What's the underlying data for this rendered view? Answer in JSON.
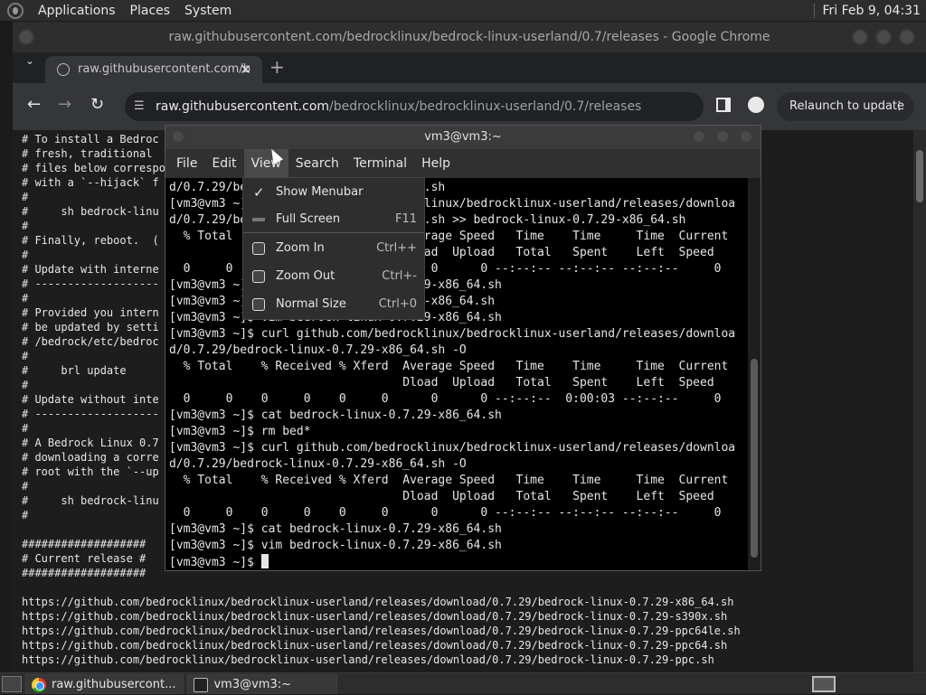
{
  "top_panel": {
    "menus": [
      "Applications",
      "Places",
      "System"
    ],
    "clock": "Fri Feb  9, 04:31"
  },
  "chrome": {
    "window_title": "raw.githubusercontent.com/bedrocklinux/bedrock-linux-userland/0.7/releases - Google Chrome",
    "tab_title": "raw.githubusercontent.com/b",
    "url_host": "raw.githubusercontent.com",
    "url_path": "/bedrocklinux/bedrocklinux-userland/0.7/releases",
    "relaunch_label": "Relaunch to update",
    "page_text": "# To install a Bedroc\n# fresh, traditional\n# files below correspo\n# with a `--hijack` f\n#\n#     sh bedrock-linu\n#\n# Finally, reboot.  (\n#\n# Update with interne\n# -------------------\n#\n# Provided you intern\n# be updated by setti\n# /bedrock/etc/bedroc\n#\n#     brl update\n#\n# Update without inte\n# -------------------\n#\n# A Bedrock Linux 0.7\n# downloading a corre\n# root with the `--up\n#\n#     sh bedrock-linu\n#\n\n################### \n# Current release # \n###################\n\nhttps://github.com/bedrocklinux/bedrocklinux-userland/releases/download/0.7.29/bedrock-linux-0.7.29-x86_64.sh\nhttps://github.com/bedrocklinux/bedrocklinux-userland/releases/download/0.7.29/bedrock-linux-0.7.29-s390x.sh\nhttps://github.com/bedrocklinux/bedrocklinux-userland/releases/download/0.7.29/bedrock-linux-0.7.29-ppc64le.sh\nhttps://github.com/bedrocklinux/bedrocklinux-userland/releases/download/0.7.29/bedrock-linux-0.7.29-ppc64.sh\nhttps://github.com/bedrocklinux/bedrocklinux-userland/releases/download/0.7.29/bedrock-linux-0.7.29-ppc.sh"
  },
  "terminal": {
    "title": "vm3@vm3:~",
    "menus": [
      "File",
      "Edit",
      "View",
      "Search",
      "Terminal",
      "Help"
    ],
    "output": "d/0.7.29/bedrock-linux-0.7.29-x86_64.sh\n[vm3@vm3 ~]$ curl github.com/bedrocklinux/bedrocklinux-userland/releases/downloa\nd/0.7.29/bedrock-linux-0.7.29-x86_64.sh >> bedrock-linux-0.7.29-x86_64.sh\n  % Total    % Received % Xferd  Average Speed   Time    Time     Time  Current\n                                 Dload  Upload   Total   Spent    Left  Speed\n  0     0    0     0    0     0      0      0 --:--:-- --:--:-- --:--:--     0\n[vm3@vm3 ~]$ cat bedrock-linux-0.7.29-x86_64.sh\n[vm3@vm3 ~]$ rm bedrock-linux-0.7.29-x86_64.sh\n[vm3@vm3 ~]$ vim bedrock-linux-0.7.29-x86_64.sh\n[vm3@vm3 ~]$ curl github.com/bedrocklinux/bedrocklinux-userland/releases/downloa\nd/0.7.29/bedrock-linux-0.7.29-x86_64.sh -O\n  % Total    % Received % Xferd  Average Speed   Time    Time     Time  Current\n                                 Dload  Upload   Total   Spent    Left  Speed\n  0     0    0     0    0     0      0      0 --:--:--  0:00:03 --:--:--     0\n[vm3@vm3 ~]$ cat bedrock-linux-0.7.29-x86_64.sh\n[vm3@vm3 ~]$ rm bed*\n[vm3@vm3 ~]$ curl github.com/bedrocklinux/bedrocklinux-userland/releases/downloa\nd/0.7.29/bedrock-linux-0.7.29-x86_64.sh -O\n  % Total    % Received % Xferd  Average Speed   Time    Time     Time  Current\n                                 Dload  Upload   Total   Spent    Left  Speed\n  0     0    0     0    0     0      0      0 --:--:-- --:--:-- --:--:--     0\n[vm3@vm3 ~]$ cat bedrock-linux-0.7.29-x86_64.sh\n[vm3@vm3 ~]$ vim bedrock-linux-0.7.29-x86_64.sh\n[vm3@vm3 ~]$ "
  },
  "view_menu": {
    "items": [
      {
        "label": "Show Menubar",
        "accel": ""
      },
      {
        "label": "Full Screen",
        "accel": "F11"
      },
      {
        "label": "Zoom In",
        "accel": "Ctrl++"
      },
      {
        "label": "Zoom Out",
        "accel": "Ctrl+-"
      },
      {
        "label": "Normal Size",
        "accel": "Ctrl+0"
      }
    ]
  },
  "taskbar": {
    "tasks": [
      "raw.githubusercont...",
      "vm3@vm3:~"
    ]
  }
}
